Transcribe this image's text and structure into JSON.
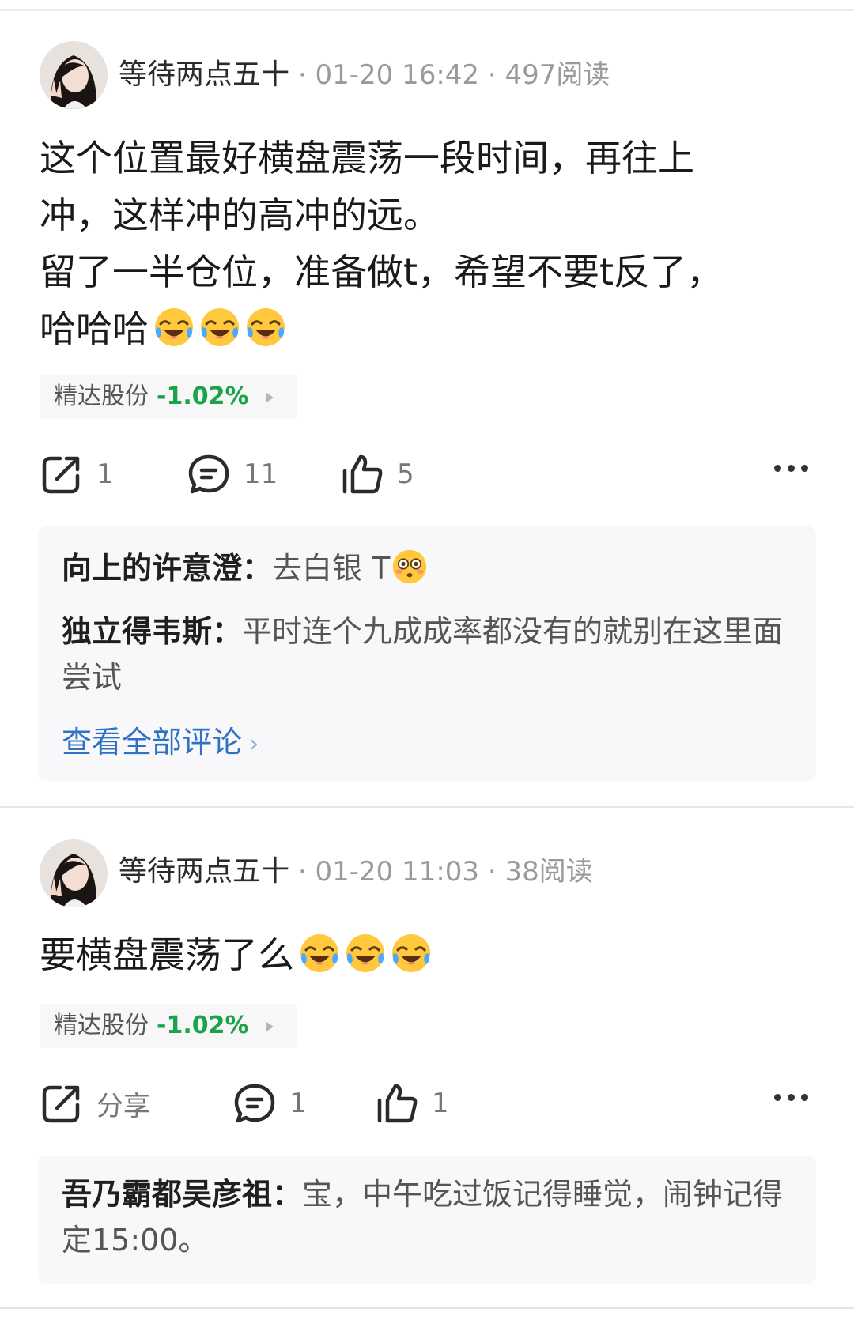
{
  "posts": [
    {
      "author": "等待两点五十",
      "time": "01-20 16:42",
      "reads": "497阅读",
      "content_lines": [
        "这个位置最好横盘震荡一段时间，再往上",
        "冲，这样冲的高冲的远。",
        "留了一半仓位，准备做t，希望不要t反了，",
        "哈哈哈"
      ],
      "emojis": [
        "laughing-crying-emoji",
        "laughing-crying-emoji",
        "laughing-crying-emoji"
      ],
      "stock": {
        "name": "精达股份",
        "change": "-1.02%"
      },
      "actions": {
        "share": "1",
        "comments": "11",
        "likes": "5"
      },
      "comments": [
        {
          "user": "向上的许意澄：",
          "text": "去白银 T"
        },
        {
          "user": "独立得韦斯：",
          "text": "平时连个九成成率都没有的就别在这里面尝试"
        }
      ],
      "view_all": "查看全部评论"
    },
    {
      "author": "等待两点五十",
      "time": "01-20 11:03",
      "reads": "38阅读",
      "content_lines": [
        "要横盘震荡了么"
      ],
      "emojis": [
        "laughing-crying-emoji",
        "laughing-crying-emoji",
        "laughing-crying-emoji"
      ],
      "stock": {
        "name": "精达股份",
        "change": "-1.02%"
      },
      "actions": {
        "share": "分享",
        "comments": "1",
        "likes": "1"
      },
      "comments": [
        {
          "user": "吾乃霸都吴彦祖：",
          "text": "宝，中午吃过饭记得睡觉，闹钟记得定15:00。"
        }
      ]
    }
  ],
  "colors": {
    "down_green": "#1aa34a",
    "link_blue": "#2f72c4",
    "meta_gray": "#9a9a9a"
  },
  "separator": " · "
}
